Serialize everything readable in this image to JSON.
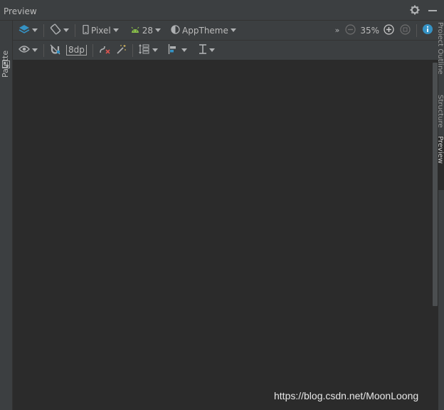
{
  "window": {
    "title": "Preview",
    "title_icons": [
      "gear-icon",
      "minimize-icon"
    ]
  },
  "left_strip": {
    "tab_label": "Palette"
  },
  "right_strip": {
    "tabs": [
      "Project Outline",
      "Structure",
      "Preview"
    ]
  },
  "toolbar1": {
    "device": "Pixel",
    "api_level": "28",
    "theme": "AppTheme",
    "zoom": "35%"
  },
  "toolbar2": {
    "margin": "8dp"
  },
  "canvas": {
    "scrollbar_fraction": 0.7
  },
  "watermark": "https://blog.csdn.net/MoonLoong",
  "colors": {
    "panel": "#3c3f41",
    "canvas": "#2b2b2b",
    "accent_blue": "#3592c4",
    "android_green": "#8bc34a",
    "error_red": "#d9534f"
  }
}
